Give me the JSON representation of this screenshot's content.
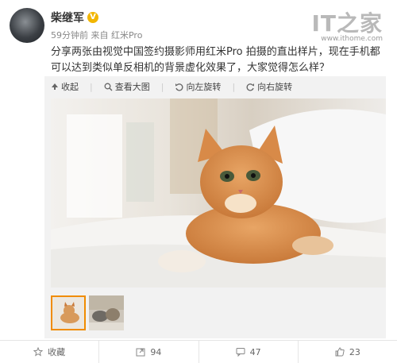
{
  "post": {
    "author": "柴继军",
    "verified_badge": "V",
    "meta": "59分钟前 来自 红米Pro",
    "text": "分享两张由视觉中国签约摄影师用红米Pro 拍摄的直出样片，现在手机都可以达到类似单反相机的背景虚化效果了，大家觉得怎么样？"
  },
  "brand": {
    "logo": "IT之家",
    "url": "www.ithome.com"
  },
  "toolbar": {
    "collapse": "收起",
    "view_large": "查看大图",
    "rotate_left": "向左旋转",
    "rotate_right": "向右旋转"
  },
  "actions": {
    "favorite": "收藏",
    "repost_count": "94",
    "comment_count": "47",
    "like_count": "23"
  },
  "colors": {
    "accent": "#f08c00",
    "verified": "#f2b600"
  }
}
